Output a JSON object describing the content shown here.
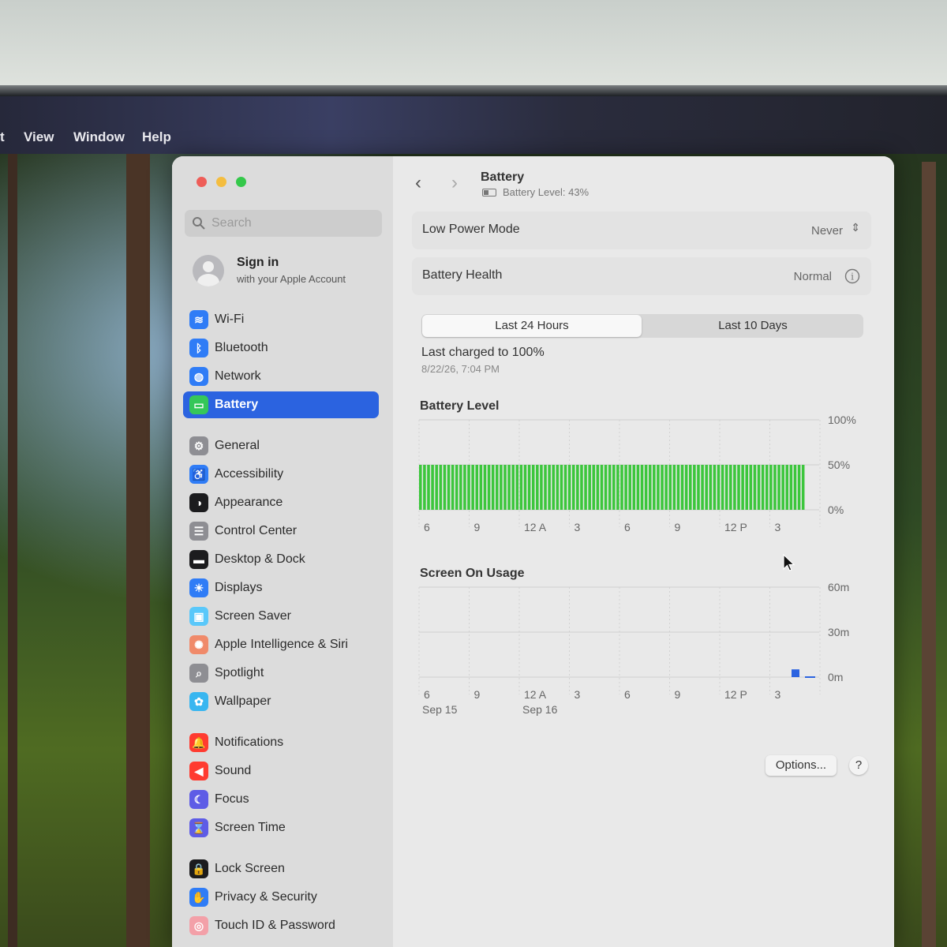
{
  "menubar": {
    "partial_label": "t",
    "items": [
      "View",
      "Window",
      "Help"
    ]
  },
  "window": {
    "traffic_lights": {
      "close": "#ee5d58",
      "minimize": "#f4bd3f",
      "zoom": "#34c84a"
    }
  },
  "sidebar": {
    "search_placeholder": "Search",
    "account": {
      "title": "Sign in",
      "subtitle": "with your Apple Account"
    },
    "items": [
      {
        "label": "Wi-Fi",
        "icon": "wifi-icon",
        "color": "#2f7cf6",
        "glyph": "≋"
      },
      {
        "label": "Bluetooth",
        "icon": "bluetooth-icon",
        "color": "#2f7cf6",
        "glyph": "ᛒ"
      },
      {
        "label": "Network",
        "icon": "globe-icon",
        "color": "#2f7cf6",
        "glyph": "◍"
      },
      {
        "label": "Battery",
        "icon": "battery-icon",
        "color": "#35c759",
        "glyph": "▭",
        "active": true
      },
      {
        "label": "General",
        "icon": "gear-icon",
        "color": "#8e8e93",
        "glyph": "⚙"
      },
      {
        "label": "Accessibility",
        "icon": "accessibility-icon",
        "color": "#2f7cf6",
        "glyph": "♿"
      },
      {
        "label": "Appearance",
        "icon": "appearance-icon",
        "color": "#1c1c1e",
        "glyph": "◑"
      },
      {
        "label": "Control Center",
        "icon": "control-center-icon",
        "color": "#8e8e93",
        "glyph": "☰"
      },
      {
        "label": "Desktop & Dock",
        "icon": "dock-icon",
        "color": "#1c1c1e",
        "glyph": "▬"
      },
      {
        "label": "Displays",
        "icon": "displays-icon",
        "color": "#2f7cf6",
        "glyph": "☀"
      },
      {
        "label": "Screen Saver",
        "icon": "screen-saver-icon",
        "color": "#5ac8fa",
        "glyph": "▣"
      },
      {
        "label": "Apple Intelligence & Siri",
        "icon": "siri-icon",
        "color": "#f08a6a",
        "glyph": "✺"
      },
      {
        "label": "Spotlight",
        "icon": "spotlight-icon",
        "color": "#8e8e93",
        "glyph": "⌕"
      },
      {
        "label": "Wallpaper",
        "icon": "wallpaper-icon",
        "color": "#38b6f0",
        "glyph": "✿"
      },
      {
        "label": "Notifications",
        "icon": "bell-icon",
        "color": "#ff3b30",
        "glyph": "🔔"
      },
      {
        "label": "Sound",
        "icon": "speaker-icon",
        "color": "#ff3b30",
        "glyph": "◀"
      },
      {
        "label": "Focus",
        "icon": "moon-icon",
        "color": "#5e5ce6",
        "glyph": "☾"
      },
      {
        "label": "Screen Time",
        "icon": "hourglass-icon",
        "color": "#5e5ce6",
        "glyph": "⌛"
      },
      {
        "label": "Lock Screen",
        "icon": "lock-icon",
        "color": "#1c1c1e",
        "glyph": "🔒"
      },
      {
        "label": "Privacy & Security",
        "icon": "hand-icon",
        "color": "#2f7cf6",
        "glyph": "✋"
      },
      {
        "label": "Touch ID & Password",
        "icon": "fingerprint-icon",
        "color": "#f3a0a8",
        "glyph": "◎"
      }
    ]
  },
  "main": {
    "title": "Battery",
    "subtitle": "Battery Level: 43%",
    "low_power": {
      "label": "Low Power Mode",
      "value": "Never"
    },
    "health": {
      "label": "Battery Health",
      "value": "Normal"
    },
    "tabs": [
      {
        "label": "Last 24 Hours",
        "selected": true
      },
      {
        "label": "Last 10 Days",
        "selected": false
      }
    ],
    "last_charged": "Last charged to 100%",
    "last_charged_date": "8/22/26, 7:04 PM",
    "options_label": "Options...",
    "help_label": "?"
  },
  "chart_data": [
    {
      "type": "bar",
      "title": "Battery Level",
      "x_ticks": [
        "6",
        "9",
        "12 A",
        "3",
        "6",
        "9",
        "12 P",
        "3"
      ],
      "y_ticks": [
        "100%",
        "50%",
        "0%"
      ],
      "ylim": [
        0,
        100
      ],
      "bar_color": "#3cc63c",
      "bar_count": 96,
      "bars_cover_fraction": 0.96,
      "values_description_constant": 50
    },
    {
      "type": "bar",
      "title": "Screen On Usage",
      "x_ticks": [
        "6",
        "9",
        "12 A",
        "3",
        "6",
        "9",
        "12 P",
        "3"
      ],
      "date_labels": [
        {
          "label": "Sep 15",
          "tick": 0
        },
        {
          "label": "Sep 16",
          "tick": 2
        }
      ],
      "y_ticks": [
        "60m",
        "30m",
        "0m"
      ],
      "ylim": [
        0,
        60
      ],
      "bar_color": "#2b63e0",
      "last_bar_value": 2
    }
  ]
}
